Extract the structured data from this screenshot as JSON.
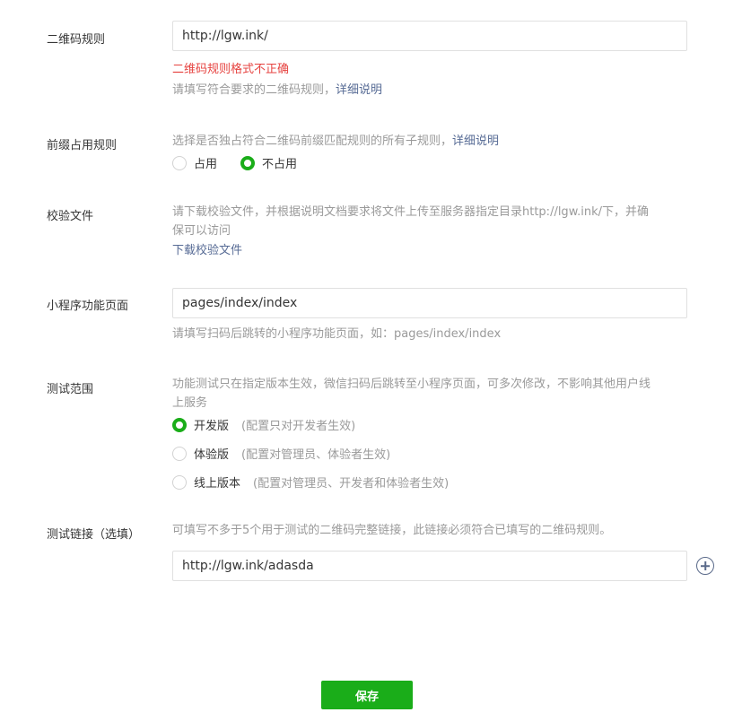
{
  "qr_rule": {
    "label": "二维码规则",
    "value": "http://lgw.ink/",
    "error": "二维码规则格式不正确",
    "hint": "请填写符合要求的二维码规则，",
    "hint_link": "详细说明"
  },
  "prefix_rule": {
    "label": "前缀占用规则",
    "hint": "选择是否独占符合二维码前缀匹配规则的所有子规则，",
    "hint_link": "详细说明",
    "options": [
      {
        "label": "占用",
        "checked": false
      },
      {
        "label": "不占用",
        "checked": true
      }
    ]
  },
  "verify_file": {
    "label": "校验文件",
    "hint_line1": "请下载校验文件，并根据说明文档要求将文件上传至服务器指定目录http://lgw.ink/下，并确",
    "hint_line2": "保可以访问",
    "download_link": "下载校验文件"
  },
  "mini_page": {
    "label": "小程序功能页面",
    "value": "pages/index/index",
    "hint": "请填写扫码后跳转的小程序功能页面，如：pages/index/index"
  },
  "test_scope": {
    "label": "测试范围",
    "hint_line1": "功能测试只在指定版本生效，微信扫码后跳转至小程序页面，可多次修改，不影响其他用户线",
    "hint_line2": "上服务",
    "options": [
      {
        "label": "开发版",
        "note": "(配置只对开发者生效)",
        "checked": true
      },
      {
        "label": "体验版",
        "note": "(配置对管理员、体验者生效)",
        "checked": false
      },
      {
        "label": "线上版本",
        "note": "(配置对管理员、开发者和体验者生效)",
        "checked": false
      }
    ]
  },
  "test_link": {
    "label": "测试链接（选填）",
    "hint": "可填写不多于5个用于测试的二维码完整链接，此链接必须符合已填写的二维码规则。",
    "value": "http://lgw.ink/adasda"
  },
  "save_label": "保存",
  "colors": {
    "accent": "#1aad19",
    "error": "#e64340",
    "link": "#576b95"
  }
}
